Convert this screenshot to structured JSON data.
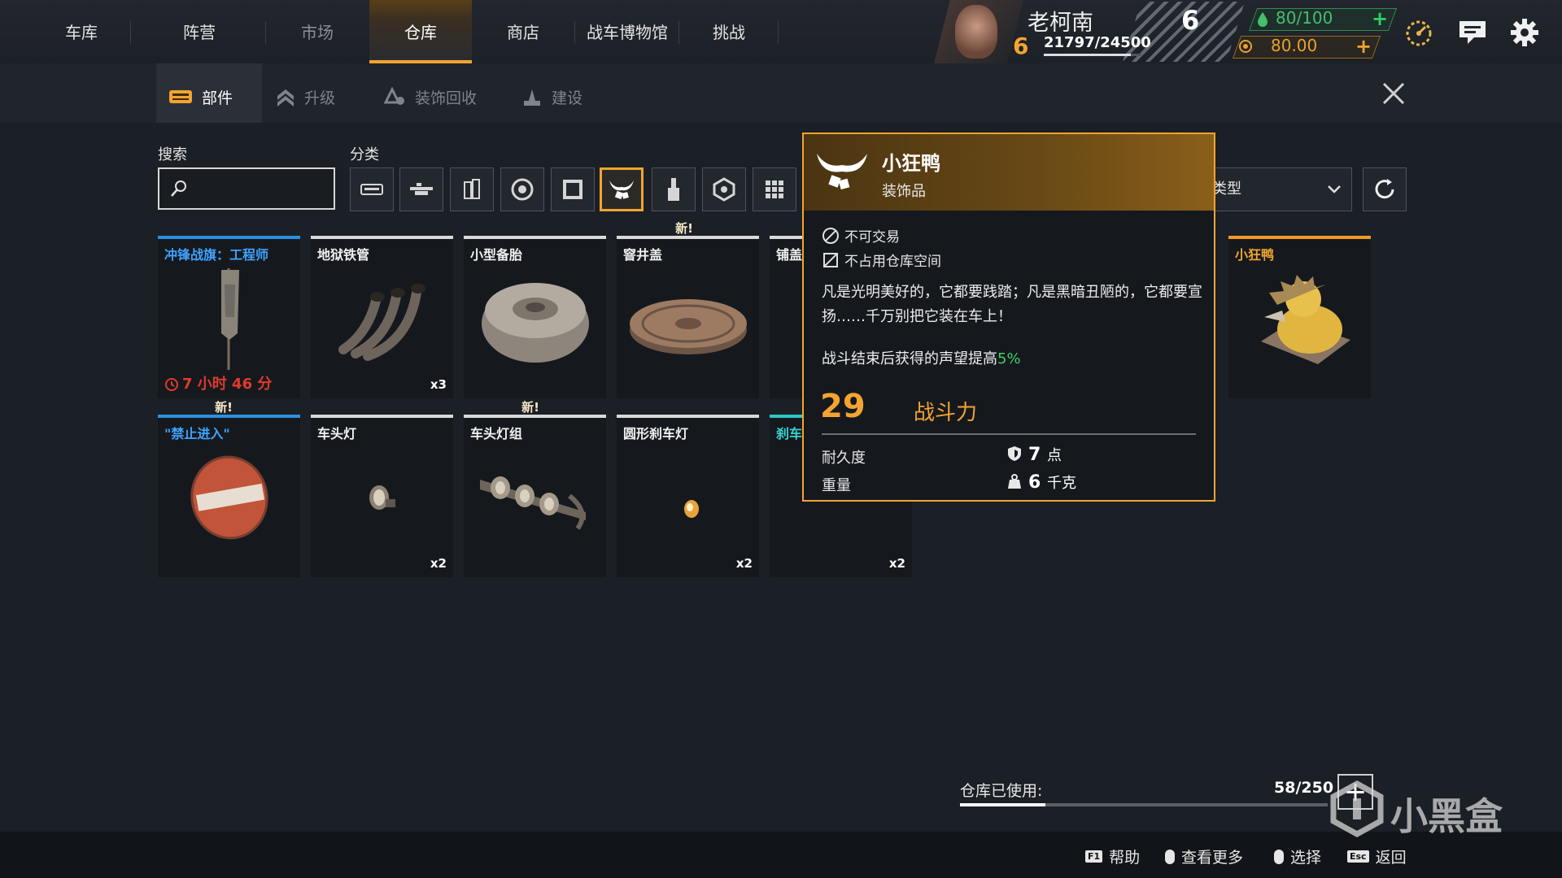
{
  "nav": {
    "tabs": [
      {
        "label": "车库"
      },
      {
        "label": "阵营"
      },
      {
        "label": "市场"
      },
      {
        "label": "仓库"
      },
      {
        "label": "商店"
      },
      {
        "label": "战车博物馆"
      },
      {
        "label": "挑战"
      }
    ],
    "active_tab": "仓库"
  },
  "player": {
    "name": "老柯南",
    "level": "6",
    "xp": "21797/24500",
    "xp_progress": 0.89,
    "rank": "6"
  },
  "resources": {
    "fuel": "80/100",
    "coins": "80.00"
  },
  "sub_tabs": {
    "parts": "部件",
    "upgrade": "升级",
    "recycle": "装饰回收",
    "build": "建设"
  },
  "filters": {
    "search_label": "搜索",
    "search_placeholder": "",
    "category_label": "分类",
    "type_select": "类型",
    "new_badge": "新!"
  },
  "items": [
    {
      "name": "冲锋战旗：工程师",
      "rarity": "blue",
      "timer": "7 小时 46 分",
      "qty": ""
    },
    {
      "name": "地狱铁管",
      "rarity": "white",
      "qty": "x3"
    },
    {
      "name": "小型备胎",
      "rarity": "white",
      "qty": ""
    },
    {
      "name": "窨井盖",
      "rarity": "white",
      "qty": ""
    },
    {
      "name": "铺盖",
      "rarity": "white",
      "qty": ""
    },
    {
      "name": "小狂鸭",
      "rarity": "gold",
      "qty": ""
    },
    {
      "name": "\"禁止进入\"",
      "rarity": "blue",
      "qty": ""
    },
    {
      "name": "车头灯",
      "rarity": "white",
      "qty": "x2"
    },
    {
      "name": "车头灯组",
      "rarity": "white",
      "qty": ""
    },
    {
      "name": "圆形刹车灯",
      "rarity": "white",
      "qty": "x2"
    },
    {
      "name": "刹车",
      "rarity": "teal",
      "qty": "x2"
    }
  ],
  "tooltip": {
    "name": "小狂鸭",
    "type": "装饰品",
    "flag1": "不可交易",
    "flag2": "不占用仓库空间",
    "description": "凡是光明美好的，它都要践踏；凡是黑暗丑陋的，它都要宣扬……千万别把它装在车上！",
    "effect_prefix": "战斗结束后获得的声望提高",
    "effect_value": "5%",
    "power": "29",
    "power_label": "战斗力",
    "durability_label": "耐久度",
    "durability_value": "7",
    "durability_unit": "点",
    "weight_label": "重量",
    "weight_value": "6",
    "weight_unit": "千克"
  },
  "storage": {
    "label": "仓库已使用:",
    "value": "58/250",
    "fraction": 0.232
  },
  "hints": {
    "help_key": "F1",
    "help": "帮助",
    "more": "查看更多",
    "select": "选择",
    "back_key": "Esc",
    "back": "返回"
  },
  "watermark": "小黑盒",
  "colors": {
    "accent": "#f3a430",
    "rare_blue": "#2d8fe0",
    "epic_gold": "#f09a24",
    "teal": "#2fc6c2",
    "green": "#3bd064",
    "timer_red": "#e23a2c"
  }
}
